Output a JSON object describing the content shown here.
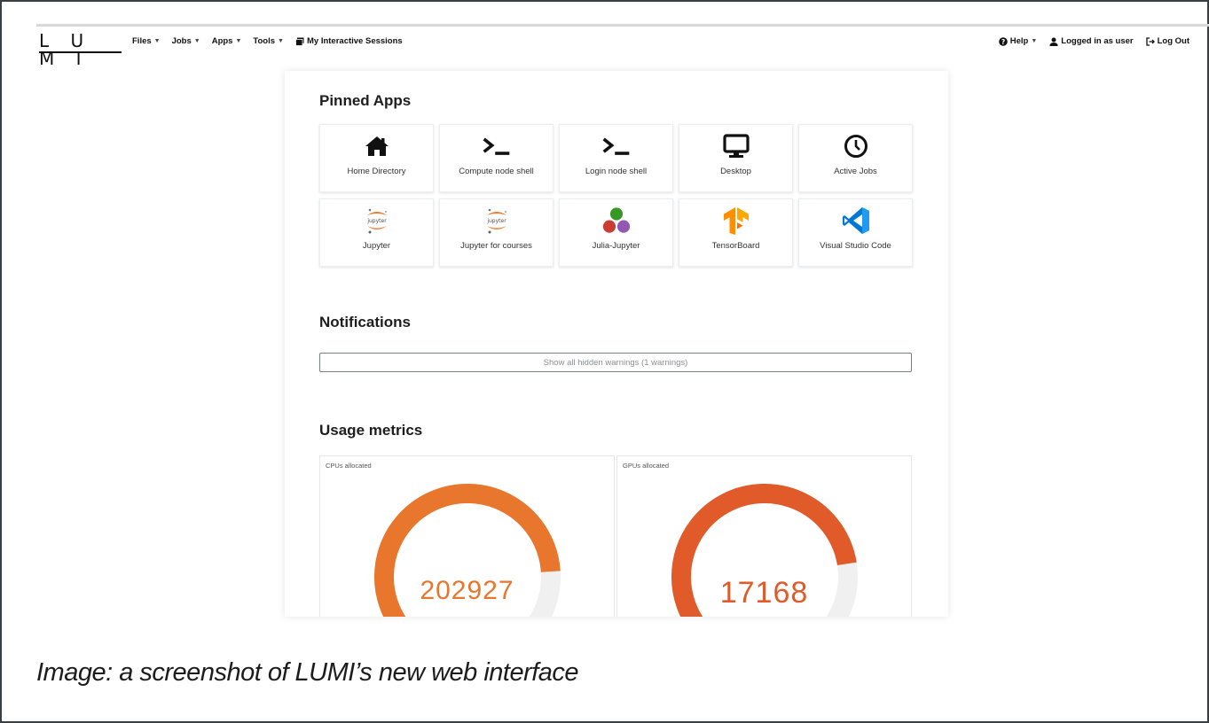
{
  "navbar": {
    "logo": "L U M I",
    "menus": [
      "Files",
      "Jobs",
      "Apps",
      "Tools"
    ],
    "sessions_label": "My Interactive Sessions",
    "help_label": "Help",
    "user_label": "Logged in as user",
    "logout_label": "Log Out"
  },
  "pinned_apps": {
    "title": "Pinned Apps",
    "apps": [
      {
        "label": "Home Directory",
        "icon": "home-icon"
      },
      {
        "label": "Compute node shell",
        "icon": "terminal-icon"
      },
      {
        "label": "Login node shell",
        "icon": "terminal-icon"
      },
      {
        "label": "Desktop",
        "icon": "desktop-icon"
      },
      {
        "label": "Active Jobs",
        "icon": "clock-icon"
      },
      {
        "label": "Jupyter",
        "icon": "jupyter-icon"
      },
      {
        "label": "Jupyter for courses",
        "icon": "jupyter-icon"
      },
      {
        "label": "Julia-Jupyter",
        "icon": "julia-icon"
      },
      {
        "label": "TensorBoard",
        "icon": "tensorflow-icon"
      },
      {
        "label": "Visual Studio Code",
        "icon": "vscode-icon"
      }
    ]
  },
  "notifications": {
    "title": "Notifications",
    "show_warnings_label": "Show all hidden warnings (1 warnings)"
  },
  "usage_metrics": {
    "title": "Usage metrics",
    "cards": [
      {
        "label": "CPUs allocated",
        "value": "202927",
        "fill_fraction": 0.82,
        "color": "#e8762c"
      },
      {
        "label": "GPUs allocated",
        "value": "17168",
        "fill_fraction": 0.8,
        "color": "#e05a2a"
      }
    ]
  },
  "caption": "Image: a screenshot of LUMI’s new web interface"
}
